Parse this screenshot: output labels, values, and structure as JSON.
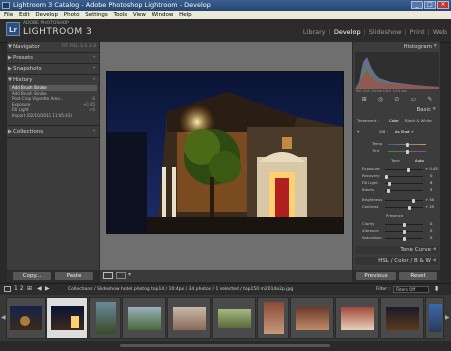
{
  "window": {
    "title": "Lightroom 3 Catalog - Adobe Photoshop Lightroom - Develop",
    "controls": [
      "minimize-icon",
      "maximize-icon",
      "close-icon"
    ]
  },
  "menu": [
    "File",
    "Edit",
    "Develop",
    "Photo",
    "Settings",
    "Tools",
    "View",
    "Window",
    "Help"
  ],
  "identity": {
    "badge": "Lr",
    "small": "ADOBE PHOTOSHOP",
    "big": "LIGHTROOM 3"
  },
  "modules": [
    "Library",
    "Develop",
    "Slideshow",
    "Print",
    "Web"
  ],
  "active_module": "Develop",
  "left": {
    "navigator": {
      "label": "Navigator",
      "options": "FIT  FILL  1:1  1:3"
    },
    "presets": "Presets",
    "snapshots": "Snapshots",
    "history": {
      "label": "History",
      "items": [
        {
          "name": "Add Brush Stroke",
          "amt": ""
        },
        {
          "name": "Add Brush Stroke",
          "amt": ""
        },
        {
          "name": "Post-Crop Vignette Amo...",
          "amt": "-6"
        },
        {
          "name": "Exposure",
          "amt": "+0.45"
        },
        {
          "name": "Fill Light",
          "amt": "+6"
        },
        {
          "name": "Import (02/10/2011 11:05:43)",
          "amt": ""
        }
      ]
    },
    "collections": "Collections",
    "copy": "Copy...",
    "paste": "Paste"
  },
  "right": {
    "histogram": "Histogram",
    "readout": "ISO 200   24mm   f/8.0   1/10 sec",
    "basic": "Basic",
    "treatment": {
      "label": "Treatment :",
      "color": "Color",
      "bw": "Black & White"
    },
    "wb": {
      "label": "WB :",
      "value": "As Shot ÷"
    },
    "temp": {
      "label": "Temp",
      "value": ""
    },
    "tint": {
      "label": "Tint",
      "value": ""
    },
    "tone": {
      "label": "Tone",
      "auto": "Auto"
    },
    "exposure": {
      "label": "Exposure",
      "value": "+ 0.45"
    },
    "recovery": {
      "label": "Recovery",
      "value": "0"
    },
    "filllight": {
      "label": "Fill Light",
      "value": "6"
    },
    "blacks": {
      "label": "Blacks",
      "value": "5"
    },
    "brightness": {
      "label": "Brightness",
      "value": "+ 50"
    },
    "contrast": {
      "label": "Contrast",
      "value": "+ 25"
    },
    "presence": "Presence",
    "clarity": {
      "label": "Clarity",
      "value": "0"
    },
    "vibrance": {
      "label": "Vibrance",
      "value": "0"
    },
    "saturation": {
      "label": "Saturation",
      "value": "0"
    },
    "tonecurve": "Tone Curve",
    "hsl": "HSL / Color / B & W",
    "previous": "Previous",
    "reset": "Reset"
  },
  "filmstrip": {
    "pages": "1  2",
    "path": "Collections / Slideshow hotel photog top14 / 10:4px / 34 photos / 1 selected / top150 m2014e2p.jpg",
    "filter_label": "Filter :",
    "filter_value": "Filters Off"
  },
  "colors": {
    "accent": "#ffffff",
    "panel": "#3c3c3c",
    "workspace": "#6f6f6f"
  }
}
